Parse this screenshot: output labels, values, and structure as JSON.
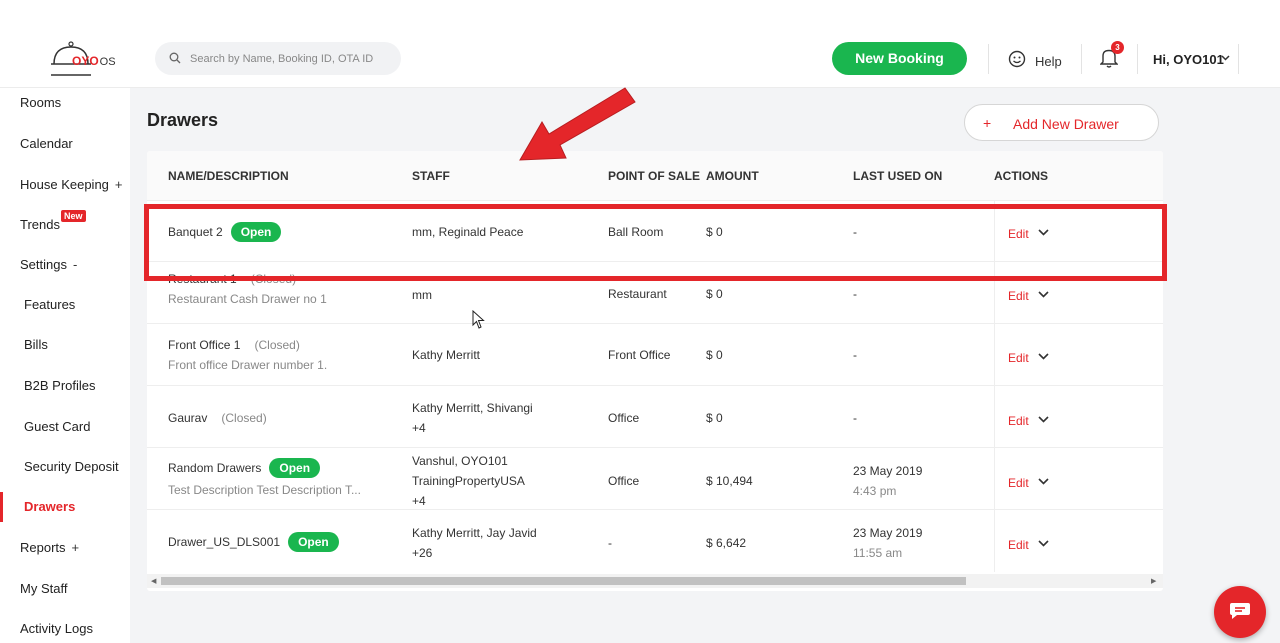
{
  "header": {
    "logo_text": "OYO",
    "logo_suffix": "OS",
    "search_placeholder": "Search by Name, Booking ID, OTA ID",
    "new_booking_label": "New Booking",
    "help_label": "Help",
    "notifications_count": "3",
    "user_greeting": "Hi, OYO101"
  },
  "sidebar": {
    "items": [
      {
        "label": "Rooms"
      },
      {
        "label": "Calendar"
      },
      {
        "label": "House Keeping",
        "expander": "+"
      },
      {
        "label": "Trends",
        "badge": "New"
      },
      {
        "label": "Settings",
        "expander": "-"
      },
      {
        "label": "Features"
      },
      {
        "label": "Bills"
      },
      {
        "label": "B2B Profiles"
      },
      {
        "label": "Guest Card"
      },
      {
        "label": "Security Deposit"
      },
      {
        "label": "Drawers"
      },
      {
        "label": "Reports",
        "expander": "+"
      },
      {
        "label": "My Staff"
      },
      {
        "label": "Activity Logs"
      }
    ]
  },
  "page": {
    "title": "Drawers",
    "add_button_icon": "+",
    "add_button_label": "Add New Drawer"
  },
  "table": {
    "columns": [
      "NAME/DESCRIPTION",
      "STAFF",
      "POINT OF SALE",
      "AMOUNT",
      "LAST USED ON",
      "ACTIONS"
    ],
    "edit_label": "Edit",
    "rows": [
      {
        "name": "Banquet 2",
        "status": "Open",
        "staff": "mm, Reginald Peace",
        "pos": "Ball Room",
        "amount": "$ 0",
        "last_used": "-"
      },
      {
        "name": "Restaurant 1",
        "status": "(Closed)",
        "description": "Restaurant Cash Drawer no 1",
        "staff": "mm",
        "pos": "Restaurant",
        "amount": "$ 0",
        "last_used": "-"
      },
      {
        "name": "Front Office 1",
        "status": "(Closed)",
        "description": "Front office Drawer number 1.",
        "staff": "Kathy Merritt",
        "pos": "Front Office",
        "amount": "$ 0",
        "last_used": "-"
      },
      {
        "name": "Gaurav",
        "status": "(Closed)",
        "staff": "Kathy Merritt, Shivangi",
        "staff_more": "+4",
        "pos": "Office",
        "amount": "$ 0",
        "last_used": "-"
      },
      {
        "name": "Random Drawers",
        "status": "Open",
        "description": "Test Description Test Description T...",
        "staff": "Vanshul, OYO101",
        "staff_line2": "TrainingPropertyUSA",
        "staff_more": "+4",
        "pos": "Office",
        "amount": "$ 10,494",
        "last_used": "23 May 2019",
        "last_used_time": "4:43 pm"
      },
      {
        "name": "Drawer_US_DLS001",
        "status": "Open",
        "staff": "Kathy Merritt, Jay Javid",
        "staff_more": "+26",
        "pos": "-",
        "amount": "$ 6,642",
        "last_used": "23 May 2019",
        "last_used_time": "11:55 am"
      }
    ]
  },
  "colors": {
    "brand_red": "#e4262a",
    "open_green": "#1ab64f"
  }
}
